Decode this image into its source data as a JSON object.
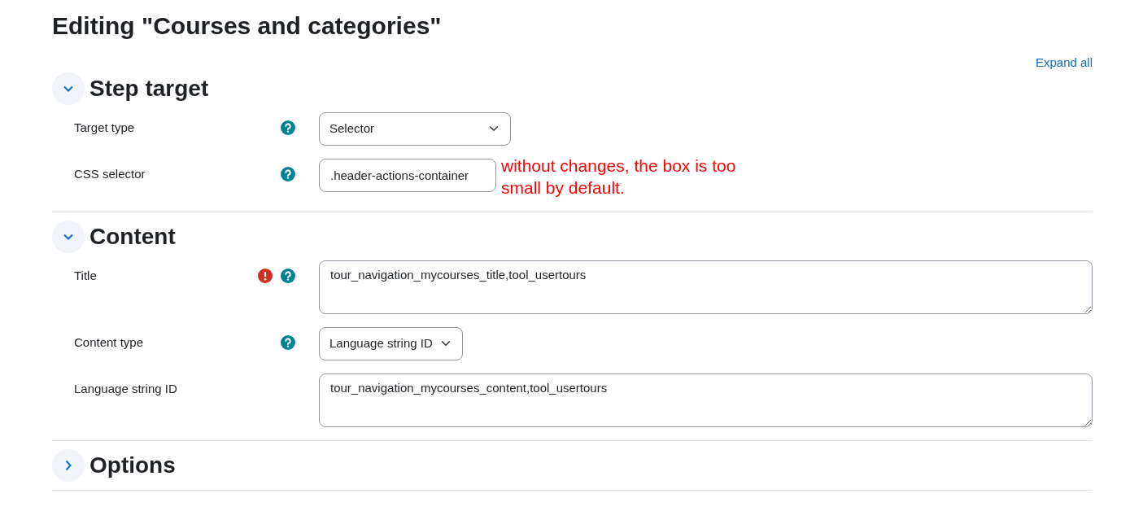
{
  "page_title": "Editing \"Courses and categories\"",
  "expand_all": "Expand all",
  "sections": [
    {
      "title": "Step target",
      "expanded": true,
      "fields": [
        {
          "label": "Target type",
          "kind": "select",
          "value": "Selector",
          "help": true,
          "error": false
        },
        {
          "label": "CSS selector",
          "kind": "input",
          "value": ".header-actions-container",
          "help": true,
          "error": false,
          "annotation": "without changes, the box is too small by default."
        }
      ]
    },
    {
      "title": "Content",
      "expanded": true,
      "fields": [
        {
          "label": "Title",
          "kind": "textarea",
          "value": "tour_navigation_mycourses_title,tool_usertours",
          "help": true,
          "error": true
        },
        {
          "label": "Content type",
          "kind": "select",
          "value": "Language string ID",
          "help": true,
          "error": false
        },
        {
          "label": "Language string ID",
          "kind": "textarea",
          "value": "tour_navigation_mycourses_content,tool_usertours",
          "help": false,
          "error": false
        }
      ]
    },
    {
      "title": "Options",
      "expanded": false
    }
  ]
}
